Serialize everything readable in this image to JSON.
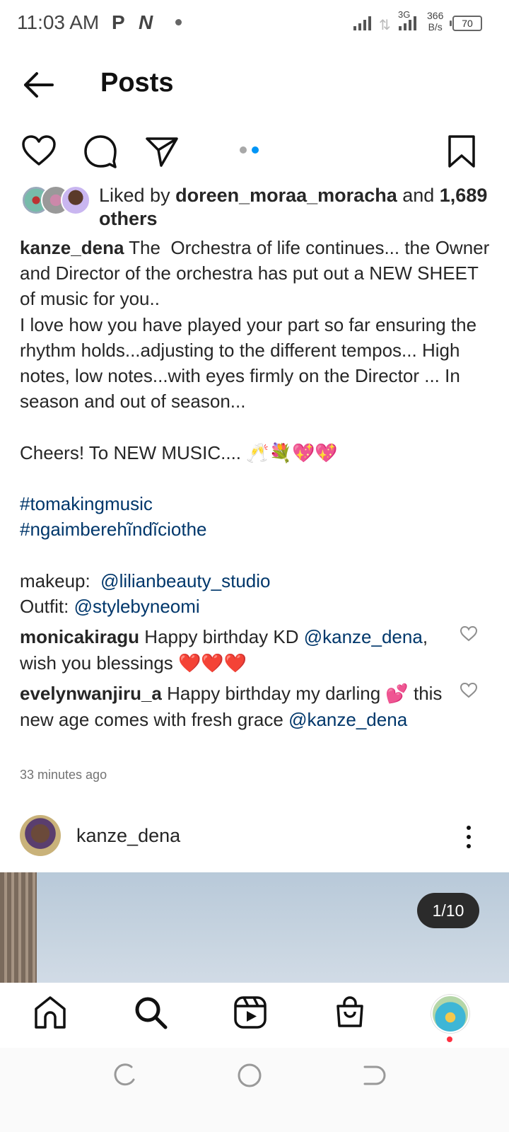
{
  "status_bar": {
    "time": "11:03 AM",
    "app_icon_p": "P",
    "app_icon_n": "N",
    "network": "3G",
    "rate_value": "366",
    "rate_unit": "B/s",
    "battery": "70"
  },
  "header": {
    "title": "Posts"
  },
  "post": {
    "liked_prefix": "Liked by ",
    "liked_user": "doreen_moraa_moracha",
    "liked_and": " and ",
    "liked_count": "1,689 others",
    "caption_user": "kanze_dena",
    "caption_text": " The  Orchestra of life continues... the Owner  and Director of the orchestra has put out a NEW SHEET of music for you..\nI love how you have played your part so far ensuring the rhythm holds...adjusting to the different tempos... High notes, low notes...with eyes firmly on the Director ... In season and out of season...\n\nCheers! To NEW MUSIC.... 🥂💐💖💖\n\n",
    "hashtag_1": "#tomakingmusic",
    "hashtag_2": "#ngaimberehĩndĩciothe",
    "makeup_label": "makeup:  ",
    "makeup_tag": "@lilianbeauty_studio",
    "outfit_label": "Outfit: ",
    "outfit_tag": "@stylebyneomi",
    "comments": [
      {
        "user": "monicakiragu",
        "text_before": " Happy birthday KD ",
        "mention": "@kanze_dena",
        "text_after": ", wish you blessings ❤️❤️❤️"
      },
      {
        "user": "evelynwanjiru_a",
        "text_before": " Happy birthday my darling 💕 this new age comes with fresh grace ",
        "mention": "@kanze_dena",
        "text_after": ""
      }
    ],
    "time_ago": "33 minutes ago",
    "page_dots": {
      "count": 2,
      "active_index": 1
    }
  },
  "next_post": {
    "username": "kanze_dena",
    "image_counter": "1/10"
  },
  "colors": {
    "link": "#00376b",
    "active_dot": "#0095f6",
    "inactive_dot": "#a8a8a8",
    "notification_dot": "#ff3040"
  },
  "icons": {
    "header": [
      "back-arrow-icon"
    ],
    "actions": [
      "heart-icon",
      "comment-icon",
      "share-icon",
      "bookmark-icon"
    ],
    "bottom_nav": [
      "home-icon",
      "search-icon",
      "reels-icon",
      "shop-icon",
      "profile-avatar"
    ],
    "system_nav": [
      "recents-icon",
      "home-circle-icon",
      "back-icon"
    ]
  }
}
